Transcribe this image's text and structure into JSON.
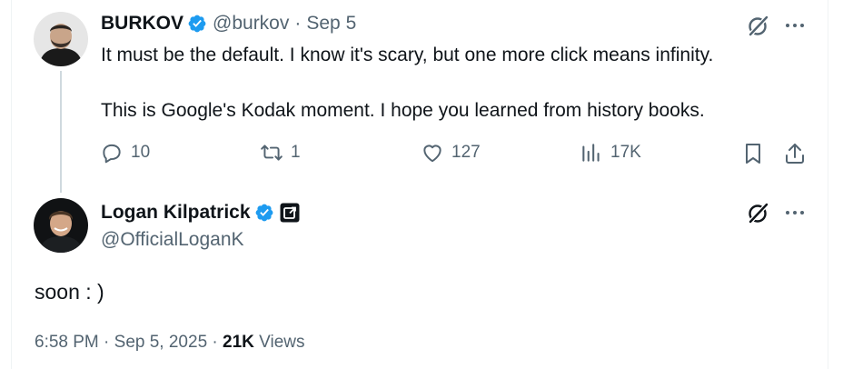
{
  "colors": {
    "text": "#0f1419",
    "muted": "#536471",
    "verified": "#1d9bf0",
    "thread_line": "#cfd9de",
    "border": "#eff3f4"
  },
  "reply_context": {
    "author": {
      "name": "BURKOV",
      "handle": "@burkov",
      "separator": "·",
      "date": "Sep 5",
      "verified": true
    },
    "text_line_1": "It must be the default. I know it's scary, but one more click means infinity.",
    "text_line_2": "This is Google's Kodak moment. I hope you learned from history books.",
    "actions": {
      "replies": "10",
      "reposts": "1",
      "likes": "127",
      "views": "17K"
    }
  },
  "main_tweet": {
    "author": {
      "name": "Logan Kilpatrick",
      "handle": "@OfficialLoganK",
      "verified": true,
      "affiliate_badge": "affiliate-badge-icon"
    },
    "text": "soon : )",
    "time": "6:58 PM",
    "separator": "·",
    "date": "Sep 5, 2025",
    "separator_2": "·",
    "views_count": "21K",
    "views_label": "Views"
  }
}
